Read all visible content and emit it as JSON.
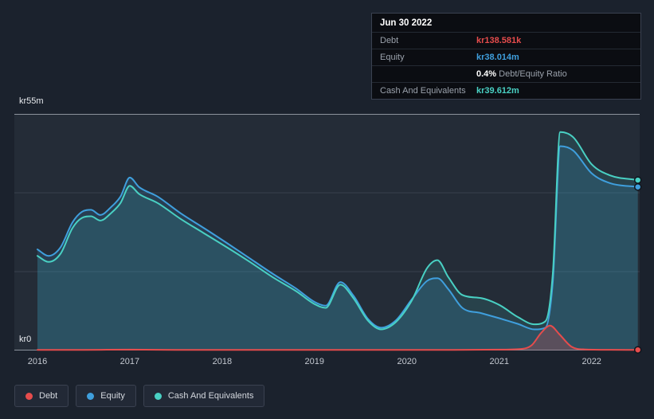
{
  "colors": {
    "debt": "#e64c4c",
    "equity": "#3f9fdd",
    "cash": "#49d0c3",
    "background": "#1b222d",
    "panel": "#242c37",
    "grid": "#39414e",
    "axis_line": "#8b929c",
    "tick_text": "#c3c8d0",
    "text_muted": "#9aa1ab"
  },
  "tooltip": {
    "date": "Jun 30 2022",
    "debt_label": "Debt",
    "debt_value": "kr138.581k",
    "equity_label": "Equity",
    "equity_value": "kr38.014m",
    "ratio_percent": "0.4%",
    "ratio_label": "Debt/Equity Ratio",
    "cash_label": "Cash And Equivalents",
    "cash_value": "kr39.612m"
  },
  "axis": {
    "y_top_label": "kr55m",
    "y_bottom_label": "kr0"
  },
  "legend": {
    "items": [
      {
        "label": "Debt"
      },
      {
        "label": "Equity"
      },
      {
        "label": "Cash And Equivalents"
      }
    ]
  },
  "chart_data": {
    "type": "area",
    "x_unit": "decimal_year",
    "y_unit": "kr_millions",
    "xlim": [
      2015.75,
      2022.52
    ],
    "ylim": [
      0,
      55
    ],
    "x_ticks": [
      "2016",
      "2017",
      "2018",
      "2019",
      "2020",
      "2021",
      "2022"
    ],
    "grid": "horizontal-faint",
    "legend_position": "bottom-left",
    "series": [
      {
        "name": "Cash And Equivalents",
        "color": "#49d0c3",
        "fill": "rgba(73,208,195,0.14)",
        "last_value_label": "kr39.612m",
        "x": [
          2016.0,
          2016.12,
          2016.25,
          2016.38,
          2016.48,
          2016.58,
          2016.68,
          2016.8,
          2016.9,
          2017.0,
          2017.1,
          2017.3,
          2017.55,
          2017.8,
          2018.05,
          2018.3,
          2018.55,
          2018.8,
          2019.0,
          2019.12,
          2019.28,
          2019.42,
          2019.58,
          2019.72,
          2019.88,
          2020.05,
          2020.22,
          2020.33,
          2020.45,
          2020.6,
          2020.8,
          2021.0,
          2021.2,
          2021.38,
          2021.5,
          2021.58,
          2021.66,
          2021.8,
          2022.0,
          2022.2,
          2022.5
        ],
        "values": [
          22.0,
          20.6,
          22.5,
          28.5,
          30.8,
          31.2,
          30.2,
          32.0,
          34.3,
          38.3,
          36.4,
          34.3,
          30.6,
          27.3,
          24.0,
          20.6,
          17.0,
          13.8,
          10.8,
          9.9,
          15.3,
          12.2,
          6.9,
          4.9,
          6.6,
          11.5,
          19.2,
          21.0,
          17.0,
          12.9,
          12.2,
          10.6,
          7.8,
          6.1,
          6.8,
          18.0,
          50.8,
          49.6,
          43.3,
          40.7,
          39.612
        ]
      },
      {
        "name": "Equity",
        "color": "#3f9fdd",
        "fill": "rgba(63,159,221,0.16)",
        "last_value_label": "kr38.014m",
        "x": [
          2016.0,
          2016.12,
          2016.25,
          2016.38,
          2016.48,
          2016.58,
          2016.68,
          2016.8,
          2016.9,
          2017.0,
          2017.1,
          2017.3,
          2017.55,
          2017.8,
          2018.05,
          2018.3,
          2018.55,
          2018.8,
          2019.0,
          2019.12,
          2019.28,
          2019.42,
          2019.58,
          2019.72,
          2019.88,
          2020.05,
          2020.22,
          2020.33,
          2020.45,
          2020.6,
          2020.8,
          2021.0,
          2021.2,
          2021.38,
          2021.5,
          2021.58,
          2021.66,
          2021.8,
          2022.0,
          2022.2,
          2022.5
        ],
        "values": [
          23.5,
          22.0,
          24.0,
          29.8,
          32.2,
          32.7,
          31.5,
          33.4,
          35.8,
          40.2,
          38.0,
          35.8,
          31.9,
          28.5,
          25.0,
          21.4,
          17.8,
          14.4,
          11.3,
          10.4,
          15.9,
          12.8,
          7.3,
          5.3,
          7.0,
          11.8,
          16.2,
          16.8,
          14.2,
          9.9,
          8.7,
          7.5,
          6.2,
          4.9,
          5.3,
          16.0,
          47.5,
          46.5,
          41.2,
          38.9,
          38.014
        ]
      },
      {
        "name": "Debt",
        "color": "#e64c4c",
        "fill": "rgba(230,76,76,0.25)",
        "last_value_label": "kr138.581k",
        "x": [
          2016.0,
          2016.5,
          2017.0,
          2017.5,
          2018.0,
          2018.5,
          2019.0,
          2019.5,
          2020.0,
          2020.5,
          2021.0,
          2021.2,
          2021.35,
          2021.45,
          2021.55,
          2021.65,
          2021.78,
          2021.92,
          2022.2,
          2022.5
        ],
        "values": [
          0.15,
          0.15,
          0.2,
          0.15,
          0.15,
          0.15,
          0.15,
          0.15,
          0.15,
          0.15,
          0.2,
          0.3,
          1.2,
          4.0,
          5.8,
          3.8,
          0.9,
          0.25,
          0.16,
          0.139
        ]
      }
    ]
  }
}
